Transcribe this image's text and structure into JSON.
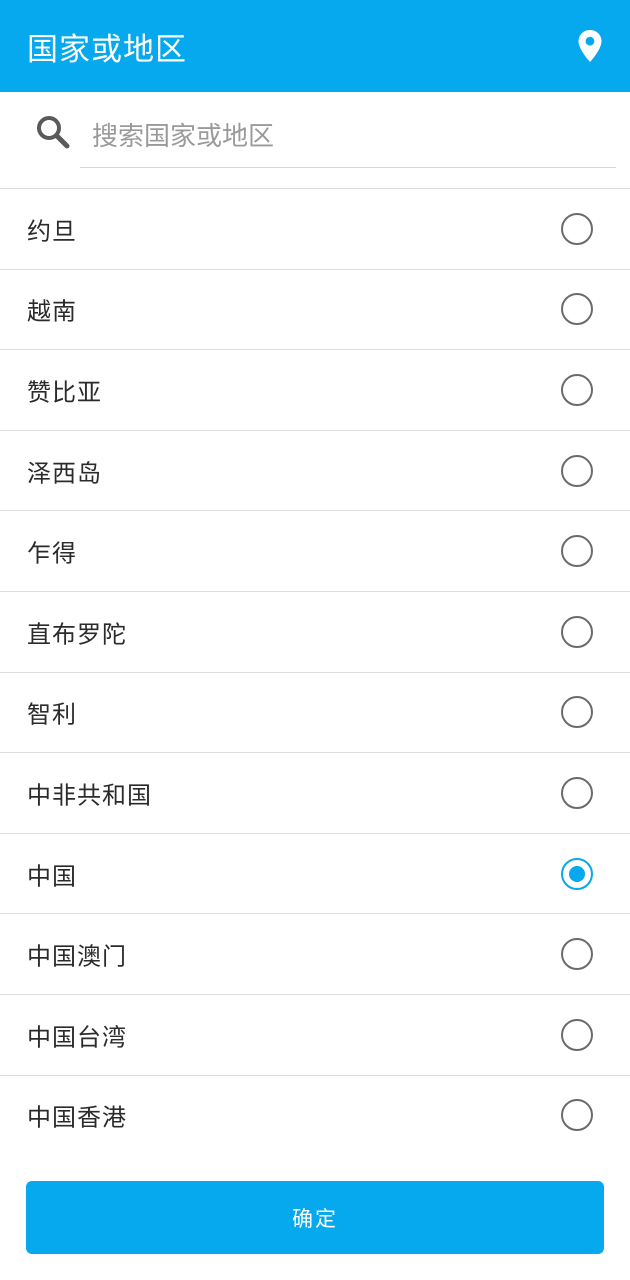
{
  "header": {
    "title": "国家或地区",
    "location_icon": "map-pin-icon"
  },
  "search": {
    "icon": "search-icon",
    "placeholder": "搜索国家或地区",
    "value": ""
  },
  "list": {
    "items": [
      {
        "label": "约旦",
        "selected": false
      },
      {
        "label": "越南",
        "selected": false
      },
      {
        "label": "赞比亚",
        "selected": false
      },
      {
        "label": "泽西岛",
        "selected": false
      },
      {
        "label": "乍得",
        "selected": false
      },
      {
        "label": "直布罗陀",
        "selected": false
      },
      {
        "label": "智利",
        "selected": false
      },
      {
        "label": "中非共和国",
        "selected": false
      },
      {
        "label": "中国",
        "selected": true
      },
      {
        "label": "中国澳门",
        "selected": false
      },
      {
        "label": "中国台湾",
        "selected": false
      },
      {
        "label": "中国香港",
        "selected": false
      }
    ]
  },
  "footer": {
    "confirm_label": "确定"
  },
  "colors": {
    "accent": "#06a8ee",
    "radio_border": "#6b6b6b",
    "divider": "#dddddd"
  }
}
